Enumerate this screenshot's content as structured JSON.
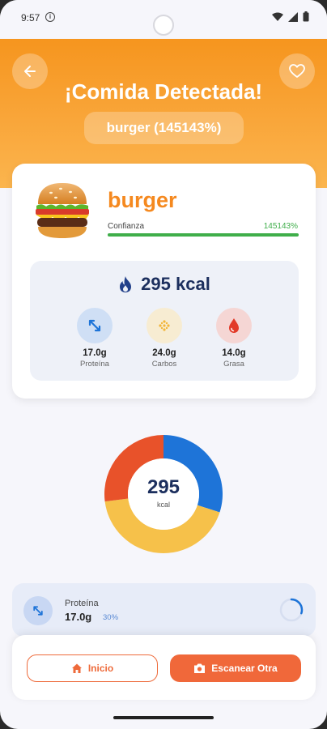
{
  "status_bar": {
    "time": "9:57",
    "info_icon": "i"
  },
  "header": {
    "title": "¡Comida Detectada!",
    "detection_label": "burger (145143%)",
    "back_icon": "arrow-left-icon",
    "favorite_icon": "heart-outline-icon",
    "gradient_colors": [
      "#f6951e",
      "#fbb54e"
    ]
  },
  "food": {
    "emoji": "🍔",
    "name": "burger",
    "confidence_label": "Confianza",
    "confidence_value": "145143%",
    "confidence_fraction": 1.0
  },
  "nutrition": {
    "calories": "295 kcal",
    "macros": [
      {
        "value": "17.0g",
        "label": "Proteína",
        "icon": "arrows-diagonal-icon",
        "color": "#1e74d8",
        "bg": "#cfdff5"
      },
      {
        "value": "24.0g",
        "label": "Carbos",
        "icon": "grain-icon",
        "color": "#f2b53a",
        "bg": "#f7ecd2"
      },
      {
        "value": "14.0g",
        "label": "Grasa",
        "icon": "drop-icon",
        "color": "#e23a28",
        "bg": "#f5d6d4"
      }
    ]
  },
  "donut": {
    "center_value": "295",
    "center_unit": "kcal",
    "segments": [
      {
        "name": "Proteína",
        "fraction": 0.3,
        "color": "#1e74d8"
      },
      {
        "name": "Carbos",
        "fraction": 0.43,
        "color": "#f6c14a"
      },
      {
        "name": "Grasa",
        "fraction": 0.27,
        "color": "#e8522a"
      }
    ]
  },
  "macro_detail": {
    "label": "Proteína",
    "value": "17.0g",
    "percent": "30%",
    "progress_fraction": 0.3
  },
  "buttons": {
    "home_label": "Inicio",
    "scan_label": "Escanear Otra"
  }
}
